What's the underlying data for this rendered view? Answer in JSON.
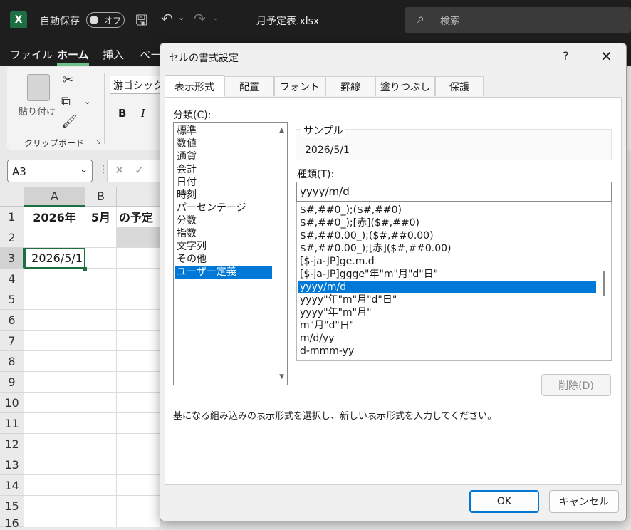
{
  "excel": {
    "autosave_label": "自動保存",
    "autosave_state": "オフ",
    "filename": "月予定表.xlsx",
    "search_placeholder": "検索",
    "menu": [
      "ファイル",
      "ホーム",
      "挿入",
      "ペー"
    ],
    "ribbon": {
      "paste_label": "貼り付け",
      "clipboard_label": "クリップボード",
      "font_name": "游ゴシック",
      "bold": "B",
      "italic": "I"
    },
    "name_box": "A3",
    "columns": [
      "A",
      "B"
    ],
    "rows": [
      "1",
      "2",
      "3",
      "4",
      "5",
      "6",
      "7",
      "8",
      "9",
      "10",
      "11",
      "12",
      "13",
      "14",
      "15",
      "16"
    ],
    "cells": {
      "A1": "2026年",
      "B1": "5月",
      "C1": "の予定",
      "A3": "2026/5/1"
    }
  },
  "dialog": {
    "title": "セルの書式設定",
    "help": "?",
    "close": "✕",
    "tabs": [
      "表示形式",
      "配置",
      "フォント",
      "罫線",
      "塗りつぶし",
      "保護"
    ],
    "active_tab": "表示形式",
    "category_label": "分類(C):",
    "categories": [
      "標準",
      "数値",
      "通貨",
      "会計",
      "日付",
      "時刻",
      "パーセンテージ",
      "分数",
      "指数",
      "文字列",
      "その他",
      "ユーザー定義"
    ],
    "selected_category": "ユーザー定義",
    "sample_label": "サンプル",
    "sample_value": "2026/5/1",
    "type_label": "種類(T):",
    "type_value": "yyyy/m/d",
    "formats": [
      "$#,##0_);($#,##0)",
      "$#,##0_);[赤]($#,##0)",
      "$#,##0.00_);($#,##0.00)",
      "$#,##0.00_);[赤]($#,##0.00)",
      "[$-ja-JP]ge.m.d",
      "[$-ja-JP]ggge\"年\"m\"月\"d\"日\"",
      "yyyy/m/d",
      "yyyy\"年\"m\"月\"d\"日\"",
      "yyyy\"年\"m\"月\"",
      "m\"月\"d\"日\"",
      "m/d/yy",
      "d-mmm-yy"
    ],
    "selected_format": "yyyy/m/d",
    "delete_label": "削除(D)",
    "description": "基になる組み込みの表示形式を選択し、新しい表示形式を入力してください。",
    "ok_label": "OK",
    "cancel_label": "キャンセル"
  }
}
